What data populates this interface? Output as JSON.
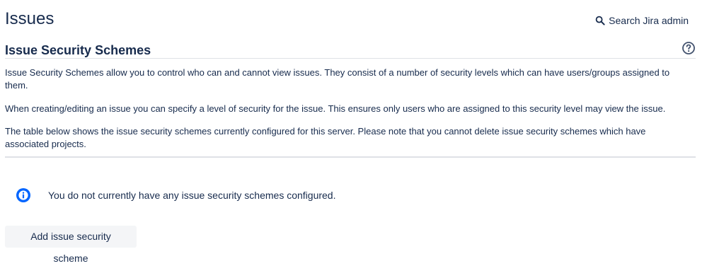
{
  "page": {
    "title": "Issues",
    "search_label": "Search Jira admin"
  },
  "section": {
    "title": "Issue Security Schemes",
    "help_icon": "question-circle-icon",
    "paragraphs": [
      "Issue Security Schemes allow you to control who can and cannot view issues. They consist of a number of security levels which can have users/groups assigned to them.",
      "When creating/editing an issue you can specify a level of security for the issue. This ensures only users who are assigned to this security level may view the issue.",
      "The table below shows the issue security schemes currently configured for this server. Please note that you cannot delete issue security schemes which have associated projects."
    ]
  },
  "info_message": {
    "icon": "info-icon",
    "text": "You do not currently have any issue security schemes configured."
  },
  "actions": {
    "add_label": "Add issue security scheme"
  },
  "colors": {
    "text": "#172b4d",
    "info_blue": "#0065ff",
    "divider": "#dfe1e6",
    "button_bg": "#f4f5f7"
  }
}
